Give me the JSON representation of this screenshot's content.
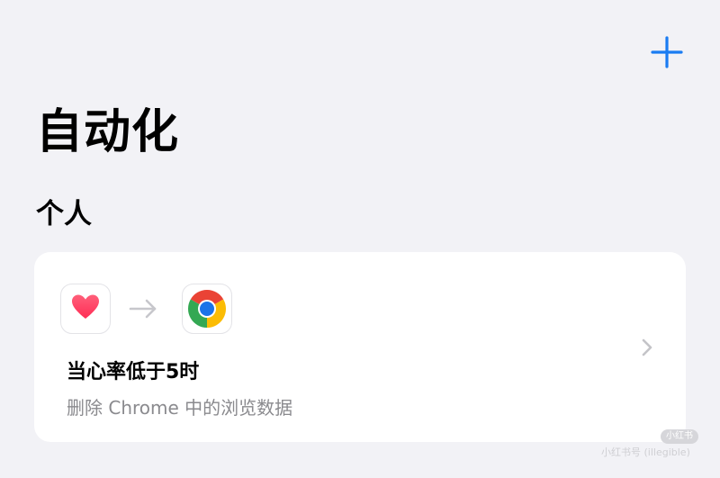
{
  "header": {
    "add_icon": "plus-icon",
    "accent_color": "#1a7cf2"
  },
  "page_title": "自动化",
  "section_title": "个人",
  "automation_card": {
    "trigger_icon": "health-heart-icon",
    "action_icon": "chrome-icon",
    "arrow_icon": "arrow-right-icon",
    "title": "当心率低于5时",
    "subtitle": "删除 Chrome 中的浏览数据",
    "chevron_icon": "chevron-right-icon"
  },
  "watermark": {
    "badge": "小红书",
    "text": "小红书号 (illegible)"
  }
}
